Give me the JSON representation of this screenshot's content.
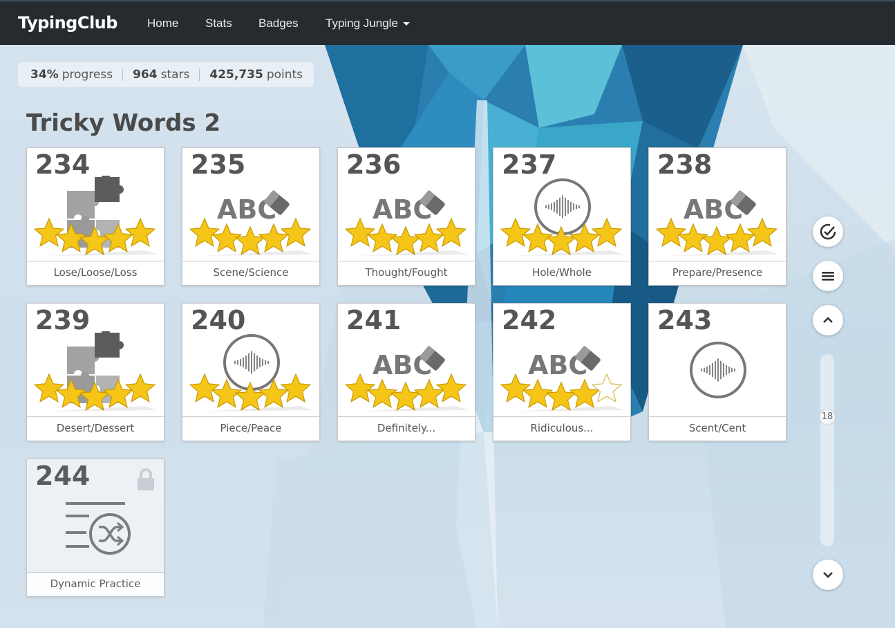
{
  "navbar": {
    "brand": "TypingClub",
    "links": [
      "Home",
      "Stats",
      "Badges"
    ],
    "dropdown_label": "Typing Jungle"
  },
  "stats": {
    "progress_value": "34%",
    "progress_label": "progress",
    "stars_value": "964",
    "stars_label": "stars",
    "points_value": "425,735",
    "points_label": "points"
  },
  "section_title": "Tricky Words 2",
  "lessons": [
    {
      "number": "234",
      "title": "Lose/Loose/Loss",
      "icon": "puzzle-icon",
      "stars": 5,
      "locked": false
    },
    {
      "number": "235",
      "title": "Scene/Science",
      "icon": "abc-eraser-icon",
      "stars": 5,
      "locked": false
    },
    {
      "number": "236",
      "title": "Thought/Fought",
      "icon": "abc-eraser-icon",
      "stars": 5,
      "locked": false
    },
    {
      "number": "237",
      "title": "Hole/Whole",
      "icon": "audio-wave-icon",
      "stars": 5,
      "locked": false
    },
    {
      "number": "238",
      "title": "Prepare/Presence",
      "icon": "abc-eraser-icon",
      "stars": 5,
      "locked": false
    },
    {
      "number": "239",
      "title": "Desert/Dessert",
      "icon": "puzzle-icon",
      "stars": 5,
      "locked": false
    },
    {
      "number": "240",
      "title": "Piece/Peace",
      "icon": "audio-wave-icon",
      "stars": 5,
      "locked": false
    },
    {
      "number": "241",
      "title": "Definitely...",
      "icon": "abc-eraser-icon",
      "stars": 5,
      "locked": false
    },
    {
      "number": "242",
      "title": "Ridiculous...",
      "icon": "abc-eraser-icon",
      "stars": 4,
      "locked": false
    },
    {
      "number": "243",
      "title": "Scent/Cent",
      "icon": "audio-wave-icon",
      "stars": 0,
      "locked": false
    },
    {
      "number": "244",
      "title": "Dynamic Practice",
      "icon": "shuffle-list-icon",
      "stars": 0,
      "locked": true
    }
  ],
  "abc_text": "ABC",
  "scroll": {
    "position_label": "18",
    "position_fraction": 0.3
  },
  "colors": {
    "navbar": "#262b30",
    "star_fill": "#f5c518",
    "icon_gray": "#777777"
  },
  "side_controls": [
    "progress-check-icon",
    "menu-icon",
    "chevron-up-icon",
    "chevron-down-icon"
  ]
}
